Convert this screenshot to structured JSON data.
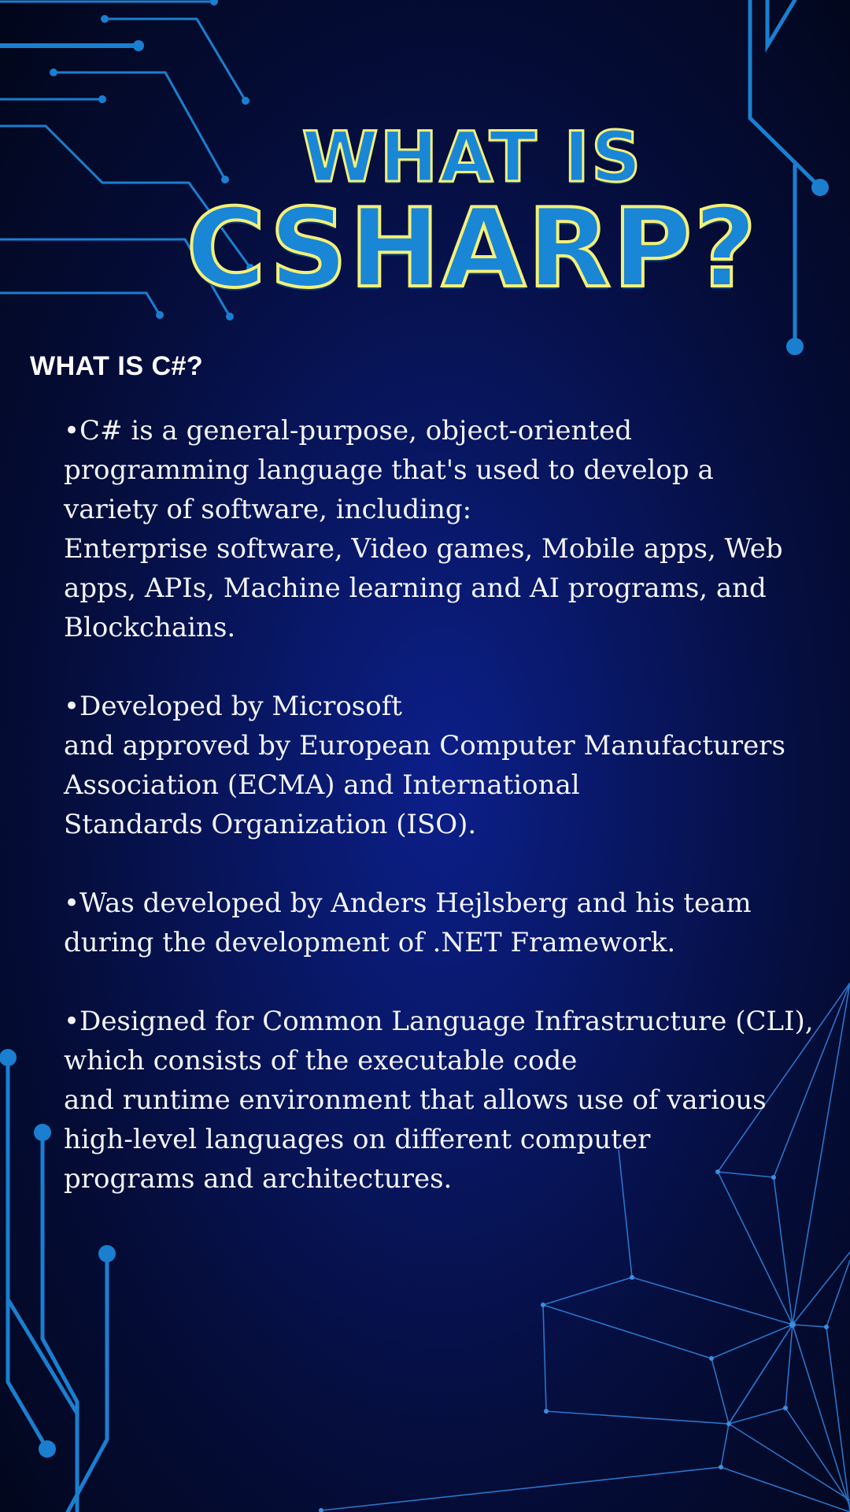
{
  "title": {
    "line1": "WHAT IS",
    "line2": "CSHARP?"
  },
  "section_heading": "WHAT IS C#?",
  "paragraphs": [
    {
      "lines": [
        "•C# is a general-purpose, object-oriented",
        "programming language that's used to develop a",
        "variety of software, including:",
        "Enterprise software, Video games, Mobile apps, Web",
        "apps, APIs, Machine learning and AI programs, and",
        "Blockchains."
      ]
    },
    {
      "lines": [
        "•Developed by Microsoft",
        "and approved by European Computer Manufacturers",
        "Association (ECMA) and International",
        "Standards Organization (ISO)."
      ]
    },
    {
      "lines": [
        "•Was developed by Anders Hejlsberg and his team",
        "during the development of .NET Framework."
      ]
    },
    {
      "lines": [
        "•Designed for Common Language Infrastructure (CLI),",
        "which consists of the executable code",
        "and runtime environment that allows use of various",
        "high-level languages on different computer",
        "programs and architectures."
      ]
    }
  ],
  "colors": {
    "circuit_blue": "#1a7fd0",
    "title_fill": "#1a86d6",
    "title_outline": "#f4f078",
    "text": "#f2f4fa"
  }
}
